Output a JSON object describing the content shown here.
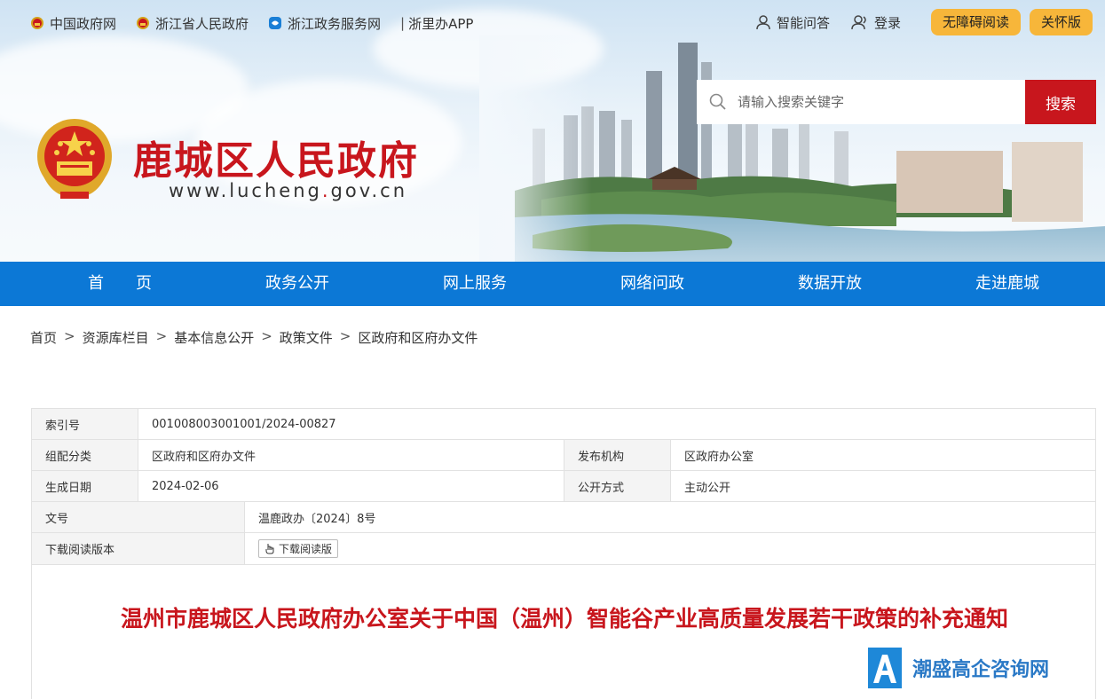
{
  "top_links": [
    {
      "label": "中国政府网",
      "icon": "emblem-icon"
    },
    {
      "label": "浙江省人民政府",
      "icon": "emblem-icon"
    },
    {
      "label": "浙江政务服务网",
      "icon": "service-icon"
    }
  ],
  "top_app": "浙里办APP",
  "top_app_sep": "|",
  "right_links": {
    "qa": "智能问答",
    "login": "登录",
    "accessible": "无障碍阅读",
    "elderly": "关怀版"
  },
  "search": {
    "placeholder": "请输入搜索关键字",
    "button": "搜索"
  },
  "site": {
    "name": "鹿城区人民政府",
    "url_prefix": "www.lucheng",
    "url_dot": ".",
    "url_suffix": "gov.cn"
  },
  "nav": [
    "首　　页",
    "政务公开",
    "网上服务",
    "网络问政",
    "数据开放",
    "走进鹿城"
  ],
  "breadcrumb": [
    "首页",
    "资源库栏目",
    "基本信息公开",
    "政策文件",
    "区政府和区府办文件"
  ],
  "breadcrumb_sep": ">",
  "meta": {
    "index_label": "索引号",
    "index_value": "001008003001001/2024-00827",
    "category_label": "组配分类",
    "category_value": "区政府和区府办文件",
    "publisher_label": "发布机构",
    "publisher_value": "区政府办公室",
    "date_label": "生成日期",
    "date_value": "2024-02-06",
    "mode_label": "公开方式",
    "mode_value": "主动公开",
    "docno_label": "文号",
    "docno_value": "温鹿政办〔2024〕8号",
    "download_label": "下载阅读版本",
    "download_button": "下载阅读版"
  },
  "article_title": "温州市鹿城区人民政府办公室关于中国（温州）智能谷产业高质量发展若干政策的补充通知",
  "watermark": "潮盛高企咨询网",
  "colors": {
    "brand_red": "#c8161d",
    "nav_blue": "#0c78d6",
    "pill_yellow": "#f7b63a"
  }
}
